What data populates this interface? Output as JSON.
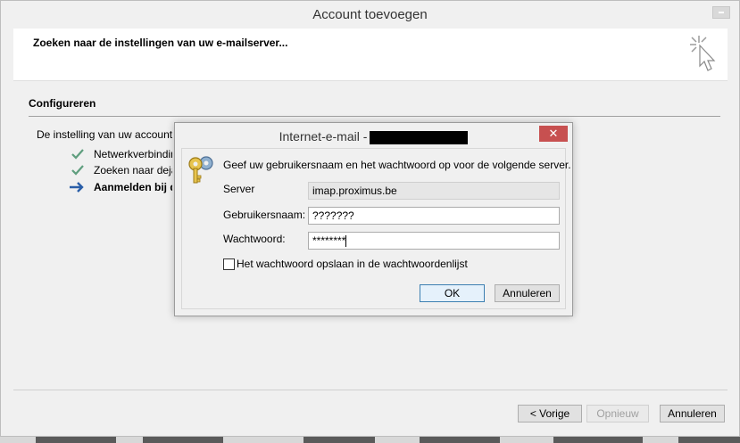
{
  "window": {
    "title": "Account toevoegen",
    "header_text": "Zoeken naar de instellingen van uw e-mailserver...",
    "section_title": "Configureren",
    "description": "De instelling van uw account wordt geconfigureerd",
    "steps": [
      {
        "label": "Netwerkverbinding",
        "status": "done",
        "icon": "check-icon"
      },
      {
        "label": "Zoeken naar deja",
        "status": "done",
        "icon": "check-icon"
      },
      {
        "label": "Aanmelden bij de",
        "status": "current",
        "icon": "arrow-right-icon"
      }
    ],
    "buttons": {
      "back": "< Vorige",
      "next": "Opnieuw",
      "cancel": "Annuleren"
    }
  },
  "dialog": {
    "title": "Internet-e-mail -",
    "close_label": "✕",
    "prompt": "Geef uw gebruikersnaam en het wachtwoord op voor de volgende server.",
    "server_label": "Server",
    "server_value": "imap.proximus.be",
    "username_label": "Gebruikersnaam:",
    "username_value": "???????",
    "password_label": "Wachtwoord:",
    "password_value": "********",
    "remember_label": "Het wachtwoord opslaan in de wachtwoordenlijst",
    "remember_checked": false,
    "ok_label": "OK",
    "cancel_label": "Annuleren"
  },
  "colors": {
    "check": "#5f9e7e",
    "arrow": "#2a5ea8",
    "close_red": "#c75050"
  }
}
